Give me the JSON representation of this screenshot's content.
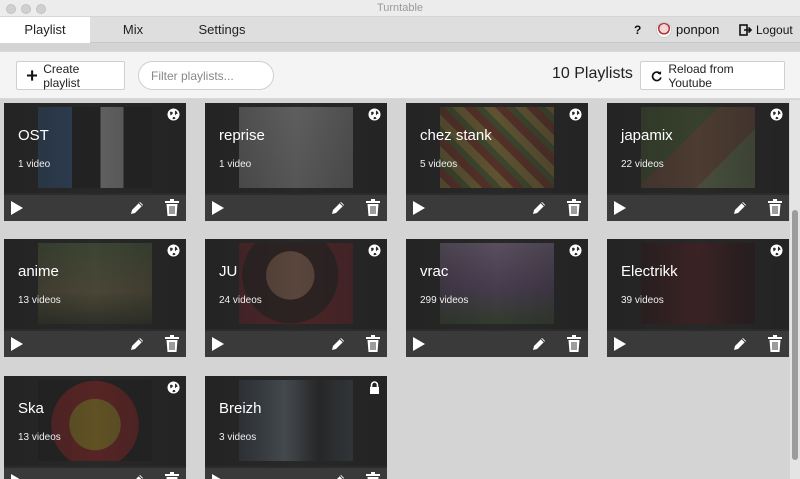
{
  "window": {
    "title": "Turntable"
  },
  "nav": {
    "tabs": [
      {
        "label": "Playlist",
        "active": true
      },
      {
        "label": "Mix",
        "active": false
      },
      {
        "label": "Settings",
        "active": false
      }
    ],
    "help": "?",
    "username": "ponpon",
    "logout_label": "Logout"
  },
  "toolbar": {
    "create_label": "Create playlist",
    "filter_placeholder": "Filter playlists...",
    "count_text": "10 Playlists",
    "reload_label": "Reload from Youtube"
  },
  "playlists": [
    {
      "title": "OST",
      "count": "1 video",
      "visibility": "globe-icon"
    },
    {
      "title": "reprise",
      "count": "1 video",
      "visibility": "globe-icon"
    },
    {
      "title": "chez stank",
      "count": "5 videos",
      "visibility": "globe-icon"
    },
    {
      "title": "japamix",
      "count": "22 videos",
      "visibility": "globe-icon"
    },
    {
      "title": "anime",
      "count": "13 videos",
      "visibility": "globe-icon"
    },
    {
      "title": "JU",
      "count": "24 videos",
      "visibility": "globe-icon"
    },
    {
      "title": "vrac",
      "count": "299 videos",
      "visibility": "globe-icon"
    },
    {
      "title": "Electrikk",
      "count": "39 videos",
      "visibility": "globe-icon"
    },
    {
      "title": "Ska",
      "count": "13 videos",
      "visibility": "globe-icon"
    },
    {
      "title": "Breizh",
      "count": "3 videos",
      "visibility": "lock-icon"
    }
  ],
  "colors": {
    "card_bg": "#2b2b2b",
    "card_bar": "#3a3a3a",
    "page_bg": "#d4d4d4",
    "active_tab": "#ffffff"
  }
}
